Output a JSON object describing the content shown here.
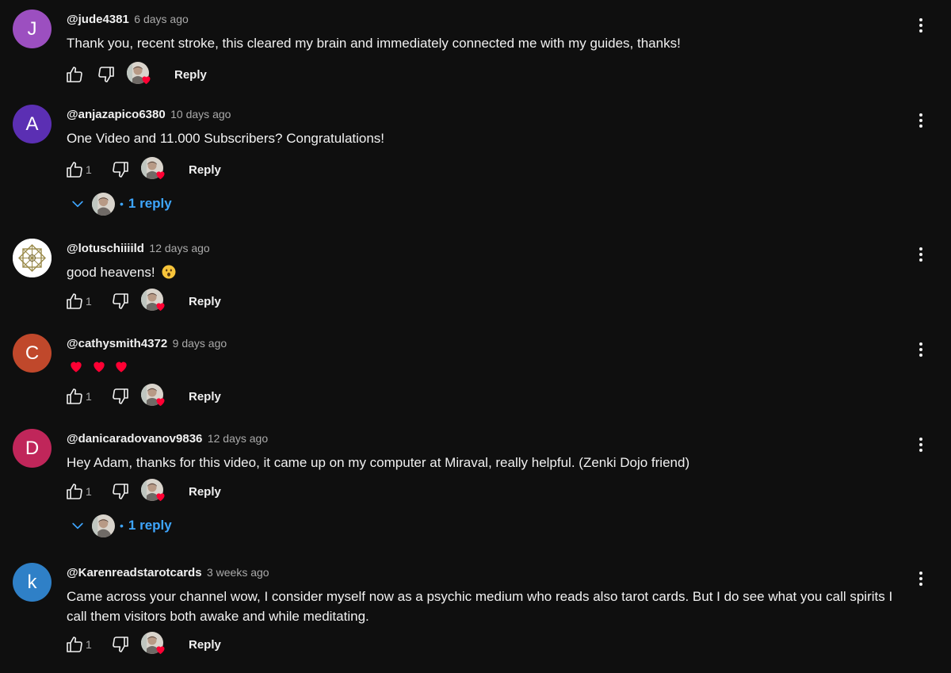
{
  "comments": [
    {
      "author": "@jude4381",
      "time": "6 days ago",
      "text": "Thank you, recent stroke, this cleared my brain and immediately connected me with my guides, thanks!",
      "avatar_letter": "J",
      "avatar_color": "#9c4fc0",
      "likes": "",
      "reply_label": "Reply"
    },
    {
      "author": "@anjazapico6380",
      "time": "10 days ago",
      "text": "One Video and 11.000 Subscribers? Congratulations!",
      "avatar_letter": "A",
      "avatar_color": "#5b2fb3",
      "likes": "1",
      "reply_label": "Reply",
      "replies_label": "1 reply"
    },
    {
      "author": "@lotuschiiiild",
      "time": "12 days ago",
      "text": "good heavens!",
      "avatar_letter": "",
      "likes": "1",
      "reply_label": "Reply"
    },
    {
      "author": "@cathysmith4372",
      "time": "9 days ago",
      "text": "",
      "avatar_letter": "C",
      "avatar_color": "#c0482b",
      "likes": "1",
      "reply_label": "Reply"
    },
    {
      "author": "@danicaradovanov9836",
      "time": "12 days ago",
      "text": "Hey Adam, thanks for this video, it came up on my computer at Miraval, really helpful. (Zenki Dojo friend)",
      "avatar_letter": "D",
      "avatar_color": "#c0265a",
      "likes": "1",
      "reply_label": "Reply",
      "replies_label": "1 reply"
    },
    {
      "author": "@Karenreadstarotcards",
      "time": "3 weeks ago",
      "text": "Came across your channel wow, I consider myself now as a psychic medium who reads also tarot cards.  But I do see what you call spirits I call them visitors both awake and while meditating.",
      "avatar_letter": "k",
      "avatar_color": "#2f80c7",
      "likes": "1",
      "reply_label": "Reply"
    }
  ],
  "colors": {
    "background": "#0f0f0f",
    "text": "#f1f1f1",
    "secondary": "#aaaaaa",
    "link": "#3ea6ff",
    "heart": "#ff0033"
  },
  "icons": [
    "like-icon",
    "dislike-icon",
    "creator-heart-icon",
    "more-vert-icon",
    "chevron-down-icon"
  ]
}
